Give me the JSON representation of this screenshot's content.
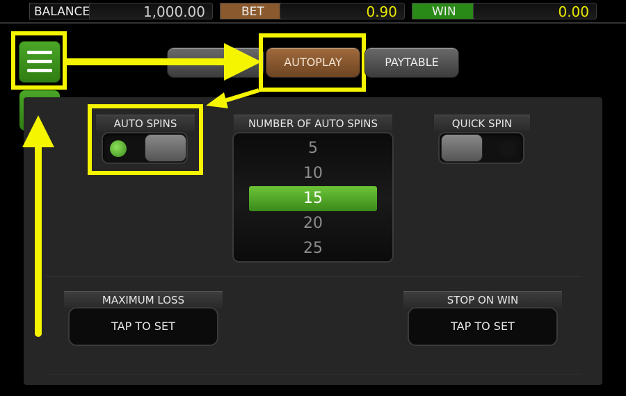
{
  "status_bar": {
    "balance_label": "BALANCE",
    "balance_value": "1,000.00",
    "bet_label": "BET",
    "bet_value": "0.90",
    "win_label": "WIN",
    "win_value": "0.00"
  },
  "tabs": [
    {
      "label": ""
    },
    {
      "label": "AUTOPLAY"
    },
    {
      "label": "PAYTABLE"
    }
  ],
  "auto_spins": {
    "label": "AUTO SPINS"
  },
  "number_of_auto_spins": {
    "label": "NUMBER OF AUTO SPINS",
    "options": [
      "5",
      "10",
      "15",
      "20",
      "25"
    ],
    "selected": "15"
  },
  "quick_spin": {
    "label": "QUICK SPIN"
  },
  "maximum_loss": {
    "label": "MAXIMUM LOSS",
    "value": "TAP TO SET"
  },
  "stop_on_win": {
    "label": "STOP ON WIN",
    "value": "TAP TO SET"
  },
  "icons": {
    "menu": "hamburger-menu-icon",
    "back": "back-arrow-icon"
  },
  "colors": {
    "accent_green": "#3c8d1a",
    "bet_brown": "#8a5a2e",
    "highlight_yellow": "#f5f500",
    "win_text": "#e8e800"
  }
}
